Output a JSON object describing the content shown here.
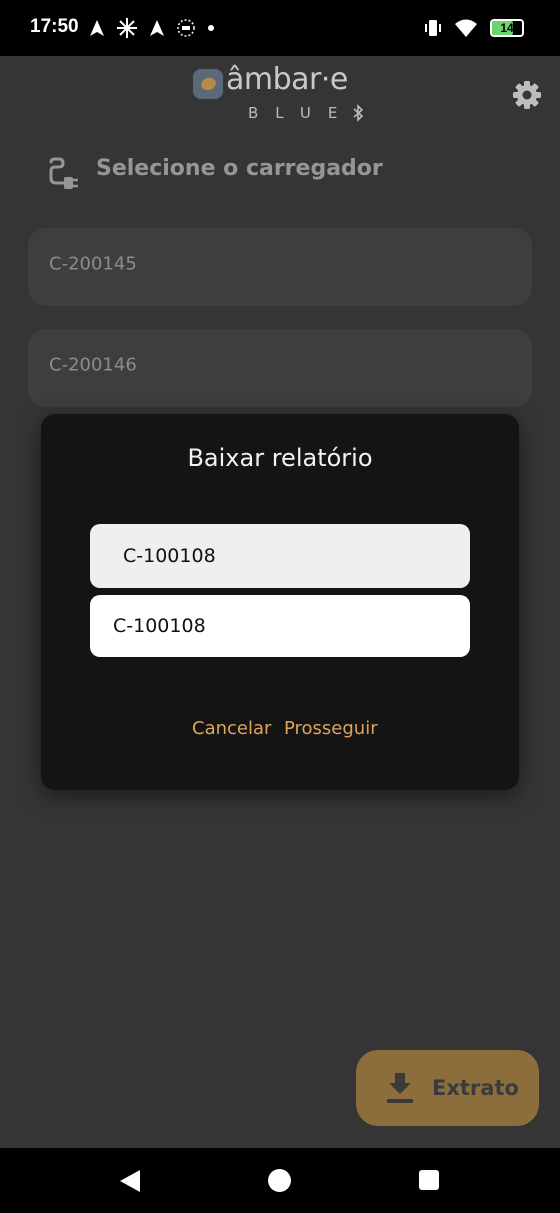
{
  "status_bar": {
    "time": "17:50",
    "battery": "14",
    "left_icons": [
      "navigation-arrow-icon",
      "sparkle-icon",
      "navigation-arrow-icon",
      "vpn-icon",
      "dot-icon"
    ],
    "right_icons": [
      "vibrate-icon",
      "wifi-icon",
      "battery-icon"
    ]
  },
  "app": {
    "logo_text": "âmbar·e",
    "logo_sub": "BLUE"
  },
  "page": {
    "title": "Selecione o carregador"
  },
  "chargers": [
    {
      "label": "C-200145"
    },
    {
      "label": "C-200146"
    }
  ],
  "dialog": {
    "title": "Baixar relatório",
    "selected_value": "C-100108",
    "input_value": "C-100108",
    "cancel_label": "Cancelar",
    "proceed_label": "Prosseguir"
  },
  "fab": {
    "label": "Extrato",
    "icon": "download-icon"
  },
  "colors": {
    "background": "#353535",
    "accent": "#dea45a",
    "fab": "#8c6e3d",
    "dialog": "#141414"
  }
}
